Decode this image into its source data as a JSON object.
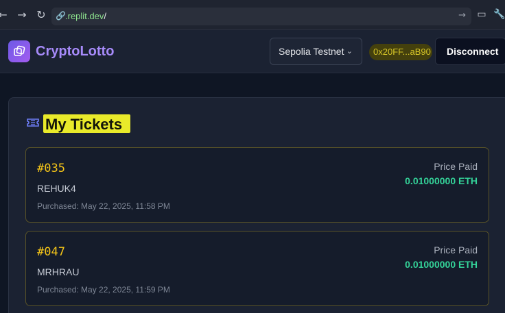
{
  "browser": {
    "url_prefix": ".replit.dev",
    "url_suffix": "/"
  },
  "header": {
    "brand": "CryptoLotto",
    "network": "Sepolia Testnet",
    "address": "0x20FF...aB90",
    "disconnect_label": "Disconnect"
  },
  "tickets_section": {
    "title": "My Tickets",
    "tickets": [
      {
        "number": "#035",
        "code": "REHUK4",
        "purchased": "Purchased: May 22, 2025, 11:58 PM",
        "price_label": "Price Paid",
        "price": "0.01000000 ETH"
      },
      {
        "number": "#047",
        "code": "MRHRAU",
        "purchased": "Purchased: May 22, 2025, 11:59 PM",
        "price_label": "Price Paid",
        "price": "0.01000000 ETH"
      }
    ]
  },
  "colors": {
    "accent": "#a78bfa",
    "ticket_number": "#f5c518",
    "price": "#34d399",
    "highlight": "#e9ea2a"
  }
}
